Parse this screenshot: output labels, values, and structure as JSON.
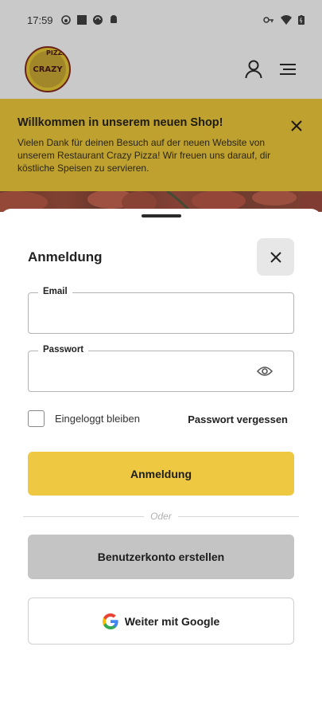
{
  "status_bar": {
    "time": "17:59",
    "icons_left": [
      "face-icon",
      "square-icon",
      "sync-icon",
      "android-icon"
    ],
    "icons_right": [
      "key-icon",
      "wifi-icon",
      "battery-icon"
    ]
  },
  "header": {
    "logo_text": "CRAZY",
    "logo_vertical": "PIZZA",
    "icons": [
      "user-icon",
      "menu-icon"
    ]
  },
  "banner": {
    "title": "Willkommen in unserem neuen Shop!",
    "text": "Vielen Dank für deinen Besuch auf der neuen Website von unserem Restaurant Crazy Pizza! Wir freuen uns darauf, dir köstliche Speisen zu servieren.",
    "background": "#bfa12f"
  },
  "login": {
    "title": "Anmeldung",
    "email_label": "Email",
    "email_value": "",
    "password_label": "Passwort",
    "password_value": "",
    "remember_label": "Eingeloggt bleiben",
    "remember_checked": false,
    "forgot_label": "Passwort vergessen",
    "submit_label": "Anmeldung",
    "divider_label": "Oder",
    "register_label": "Benutzerkonto erstellen",
    "google_label": "Weiter mit Google"
  },
  "colors": {
    "accent": "#efc842",
    "secondary_button": "#c4c4c4"
  }
}
